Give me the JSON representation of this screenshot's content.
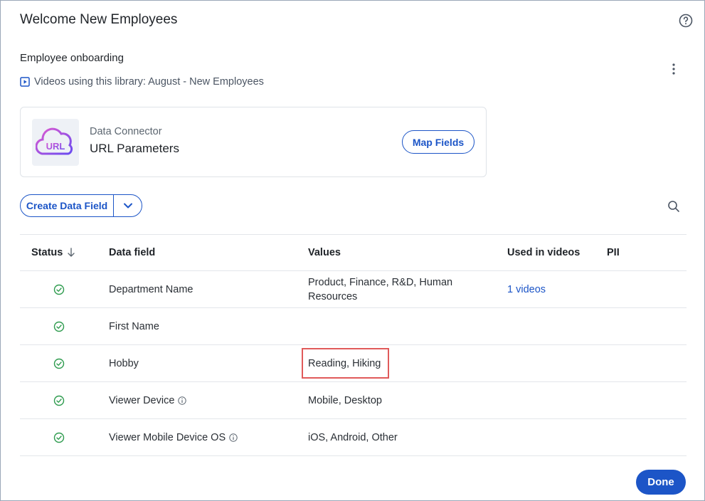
{
  "dialog": {
    "title": "Welcome New Employees",
    "help_icon": "question-circle-icon"
  },
  "library": {
    "name": "Employee onboarding",
    "videos_text": "Videos using this library: August - New Employees",
    "more_icon": "kebab-menu-icon"
  },
  "connector": {
    "kind_label": "Data Connector",
    "name": "URL Parameters",
    "logo_text": "URL",
    "map_fields_label": "Map Fields"
  },
  "toolbar": {
    "create_label": "Create Data Field",
    "dropdown_icon": "chevron-down-icon",
    "search_icon": "search-icon"
  },
  "table": {
    "headers": {
      "status": "Status",
      "field": "Data field",
      "values": "Values",
      "used": "Used in videos",
      "pii": "PII"
    },
    "rows": [
      {
        "field": "Department Name",
        "values": "Product, Finance, R&D, Human Resources",
        "used": "1 videos",
        "info": false
      },
      {
        "field": "First Name",
        "values": "",
        "used": "",
        "info": false
      },
      {
        "field": "Hobby",
        "values": "Reading, Hiking",
        "used": "",
        "info": false
      },
      {
        "field": "Viewer Device",
        "values": "Mobile, Desktop",
        "used": "",
        "info": true
      },
      {
        "field": "Viewer Mobile Device OS",
        "values": "iOS, Android, Other",
        "used": "",
        "info": true
      }
    ]
  },
  "footer": {
    "done_label": "Done"
  },
  "colors": {
    "accent": "#1c55c7",
    "success": "#2e9b4e",
    "highlight": "#e05a5a"
  }
}
